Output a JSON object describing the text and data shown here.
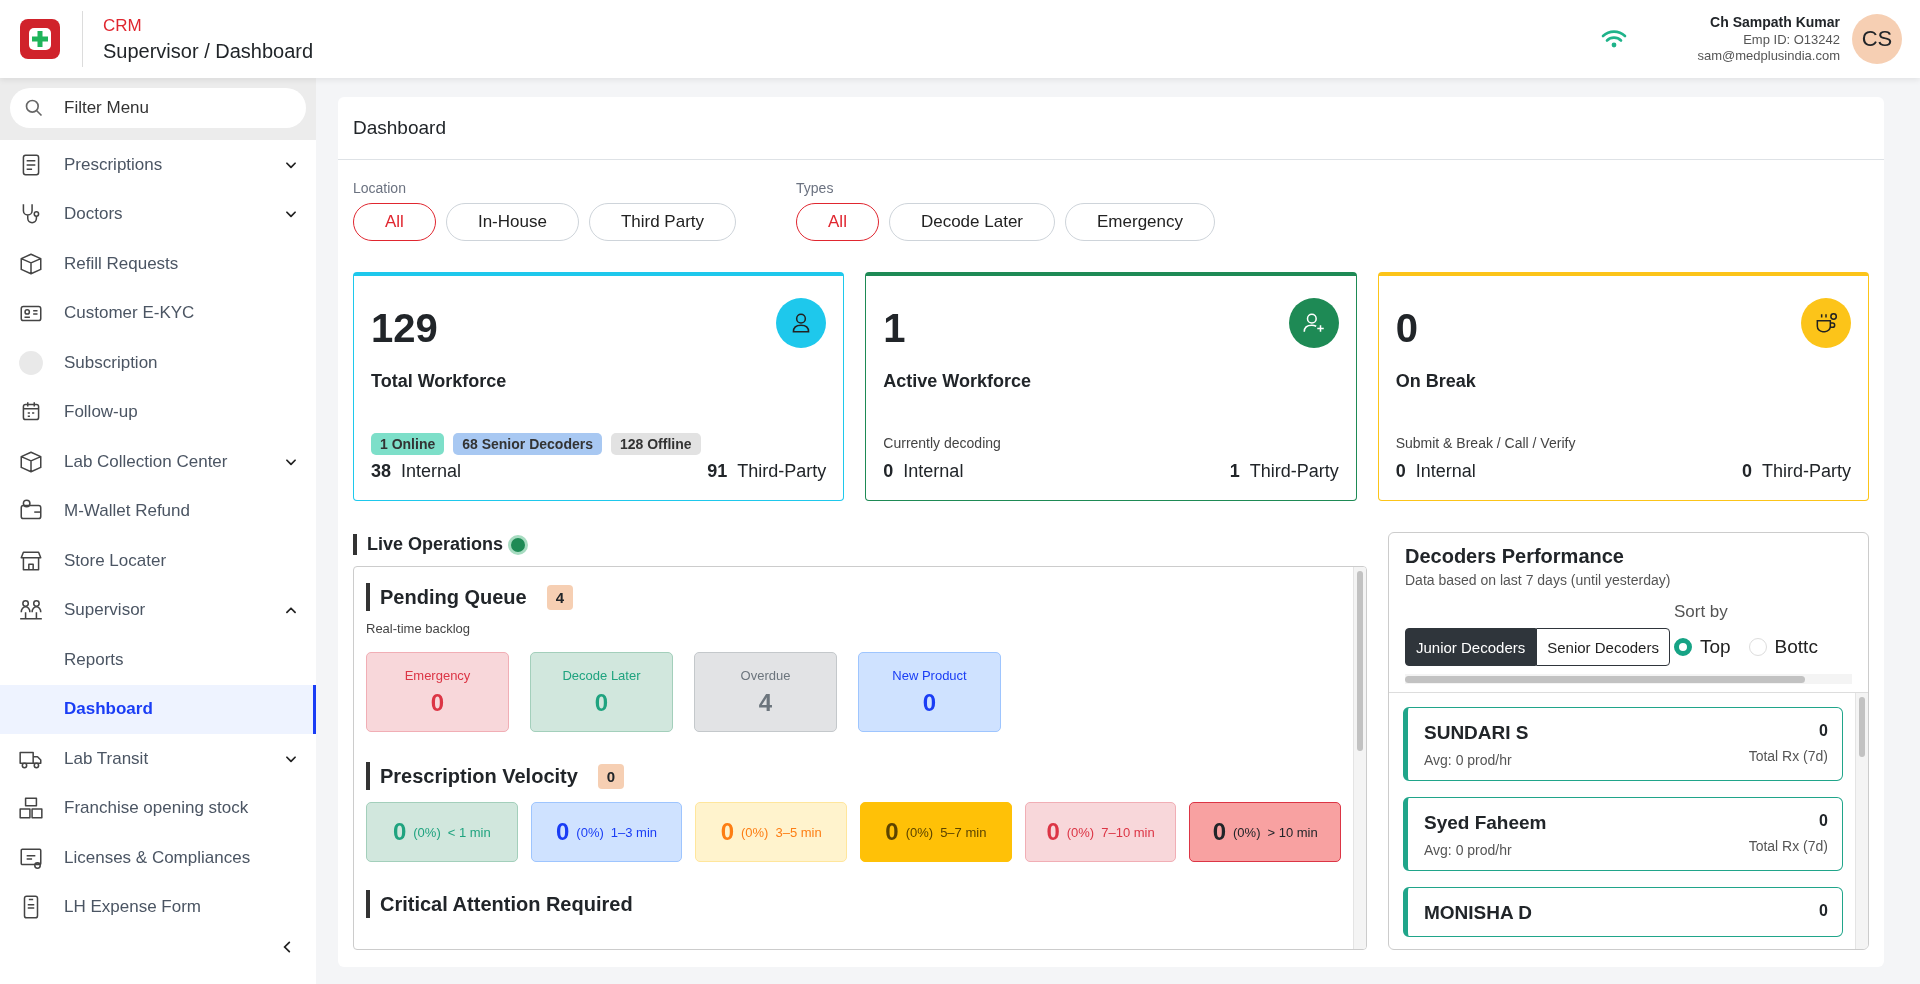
{
  "header": {
    "app_name": "CRM",
    "breadcrumb": "Supervisor / Dashboard",
    "user": {
      "name": "Ch Sampath Kumar",
      "emp_id": "Emp ID: O13242",
      "email": "sam@medplusindia.com",
      "initials": "CS"
    }
  },
  "sidebar": {
    "search": {
      "placeholder": "Filter Menu"
    },
    "items": [
      {
        "label": "Prescriptions",
        "kind": "group",
        "expanded": false,
        "selected": false
      },
      {
        "label": "Doctors",
        "kind": "group",
        "expanded": false,
        "selected": false
      },
      {
        "label": "Refill Requests",
        "kind": "link",
        "selected": false
      },
      {
        "label": "Customer E-KYC",
        "kind": "link",
        "selected": false
      },
      {
        "label": "Subscription",
        "kind": "link",
        "selected": false
      },
      {
        "label": "Follow-up",
        "kind": "link",
        "selected": false
      },
      {
        "label": "Lab Collection Center",
        "kind": "group",
        "expanded": false,
        "selected": false
      },
      {
        "label": "M-Wallet Refund",
        "kind": "link",
        "selected": false
      },
      {
        "label": "Store Locater",
        "kind": "link",
        "selected": false
      },
      {
        "label": "Supervisor",
        "kind": "group",
        "expanded": true,
        "selected": false,
        "children": [
          {
            "label": "Reports",
            "selected": false
          },
          {
            "label": "Dashboard",
            "selected": true
          }
        ]
      },
      {
        "label": "Lab Transit",
        "kind": "group",
        "expanded": false,
        "selected": false
      },
      {
        "label": "Franchise opening stock",
        "kind": "link",
        "selected": false
      },
      {
        "label": "Licenses & Compliances",
        "kind": "link",
        "selected": false
      },
      {
        "label": "LH Expense Form",
        "kind": "link",
        "selected": false
      }
    ]
  },
  "main": {
    "title": "Dashboard",
    "filters": [
      {
        "label": "Location",
        "options": [
          {
            "label": "All",
            "selected": true
          },
          {
            "label": "In-House",
            "selected": false
          },
          {
            "label": "Third Party",
            "selected": false
          }
        ]
      },
      {
        "label": "Types",
        "options": [
          {
            "label": "All",
            "selected": true
          },
          {
            "label": "Decode Later",
            "selected": false
          },
          {
            "label": "Emergency",
            "selected": false
          }
        ]
      }
    ],
    "stat_cards": [
      {
        "value": "129",
        "title": "Total Workforce",
        "color": "#1ec8ec",
        "badges": [
          {
            "label": "1 Online",
            "color": "#7ddfc9"
          },
          {
            "label": "68 Senior Decoders",
            "color": "#a8c8f2"
          },
          {
            "label": "128 Offline",
            "color": "#e2e2e2"
          }
        ],
        "internal": {
          "value": "38",
          "label": "Internal"
        },
        "third_party": {
          "value": "91",
          "label": "Third-Party"
        }
      },
      {
        "value": "1",
        "title": "Active Workforce",
        "color": "#1e8a55",
        "note": "Currently decoding",
        "internal": {
          "value": "0",
          "label": "Internal"
        },
        "third_party": {
          "value": "1",
          "label": "Third-Party"
        }
      },
      {
        "value": "0",
        "title": "On Break",
        "color": "#fcc419",
        "note": "Submit & Break / Call / Verify",
        "internal": {
          "value": "0",
          "label": "Internal"
        },
        "third_party": {
          "value": "0",
          "label": "Third-Party"
        }
      }
    ],
    "live_operations": {
      "title": "Live Operations",
      "pending_queue": {
        "title": "Pending Queue",
        "count": "4",
        "subtitle": "Real-time backlog",
        "tiles": [
          {
            "label": "Emergency",
            "value": "0",
            "kind": "rose"
          },
          {
            "label": "Decode Later",
            "value": "0",
            "kind": "mint"
          },
          {
            "label": "Overdue",
            "value": "4",
            "kind": "grey"
          },
          {
            "label": "New Product",
            "value": "0",
            "kind": "blue"
          }
        ]
      },
      "velocity": {
        "title": "Prescription Velocity",
        "count": "0",
        "tiles": [
          {
            "value": "0",
            "percent": "(0%)",
            "range": "< 1 min",
            "kind": "mint"
          },
          {
            "value": "0",
            "percent": "(0%)",
            "range": "1–3 min",
            "kind": "blue"
          },
          {
            "value": "0",
            "percent": "(0%)",
            "range": "3–5 min",
            "kind": "cream"
          },
          {
            "value": "0",
            "percent": "(0%)",
            "range": "5–7 min",
            "kind": "amber"
          },
          {
            "value": "0",
            "percent": "(0%)",
            "range": "7–10 min",
            "kind": "rose"
          },
          {
            "value": "0",
            "percent": "(0%)",
            "range": "> 10 min",
            "kind": "red"
          }
        ]
      },
      "critical": {
        "title": "Critical Attention Required"
      }
    },
    "decoders_performance": {
      "title": "Decoders Performance",
      "subtitle": "Data based on last 7 days (until yesterday)",
      "tabs": [
        {
          "label": "Junior Decoders",
          "selected": true
        },
        {
          "label": "Senior Decoders",
          "selected": false
        }
      ],
      "sort_label": "Sort by",
      "sort_options": [
        {
          "label": "Top",
          "selected": true
        },
        {
          "label": "Bottc",
          "selected": false
        }
      ],
      "decoders": [
        {
          "name": "SUNDARI S",
          "avg": "Avg: 0 prod/hr",
          "total": "0",
          "total_label": "Total Rx (7d)"
        },
        {
          "name": "Syed Faheem",
          "avg": "Avg: 0 prod/hr",
          "total": "0",
          "total_label": "Total Rx (7d)"
        },
        {
          "name": "MONISHA D",
          "total": "0"
        }
      ]
    }
  }
}
